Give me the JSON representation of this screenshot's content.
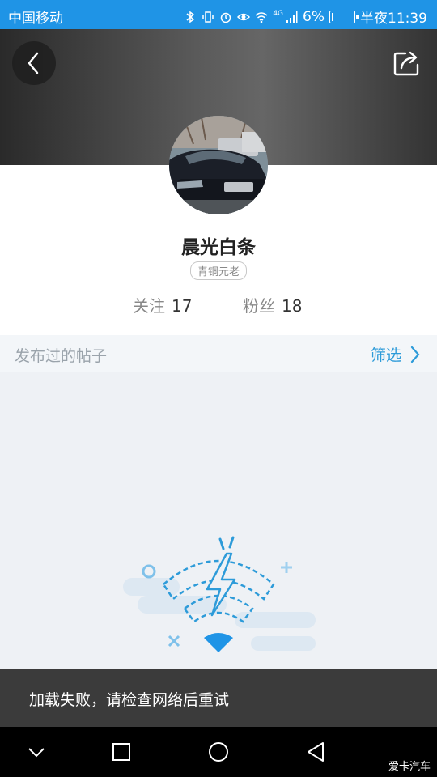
{
  "status_bar": {
    "carrier": "中国移动",
    "network": "4G",
    "battery_text": "6%",
    "battery_level": 0.06,
    "time": "半夜11:39"
  },
  "header": {
    "back_icon": "back-arrow-icon",
    "share_icon": "share-icon"
  },
  "profile": {
    "username": "晨光白条",
    "badge": "青铜元老",
    "follow_label": "关注",
    "follow_count": "17",
    "fans_label": "粉丝",
    "fans_count": "18"
  },
  "posts": {
    "label": "发布过的帖子",
    "filter_label": "筛选"
  },
  "toast": {
    "message": "加载失败，请检查网络后重试"
  },
  "nav": {
    "watermark": "爱卡汽车"
  },
  "colors": {
    "status_bar": "#1f94e6",
    "accent": "#2d9bd9",
    "toast_bg": "#3b3b3b"
  }
}
